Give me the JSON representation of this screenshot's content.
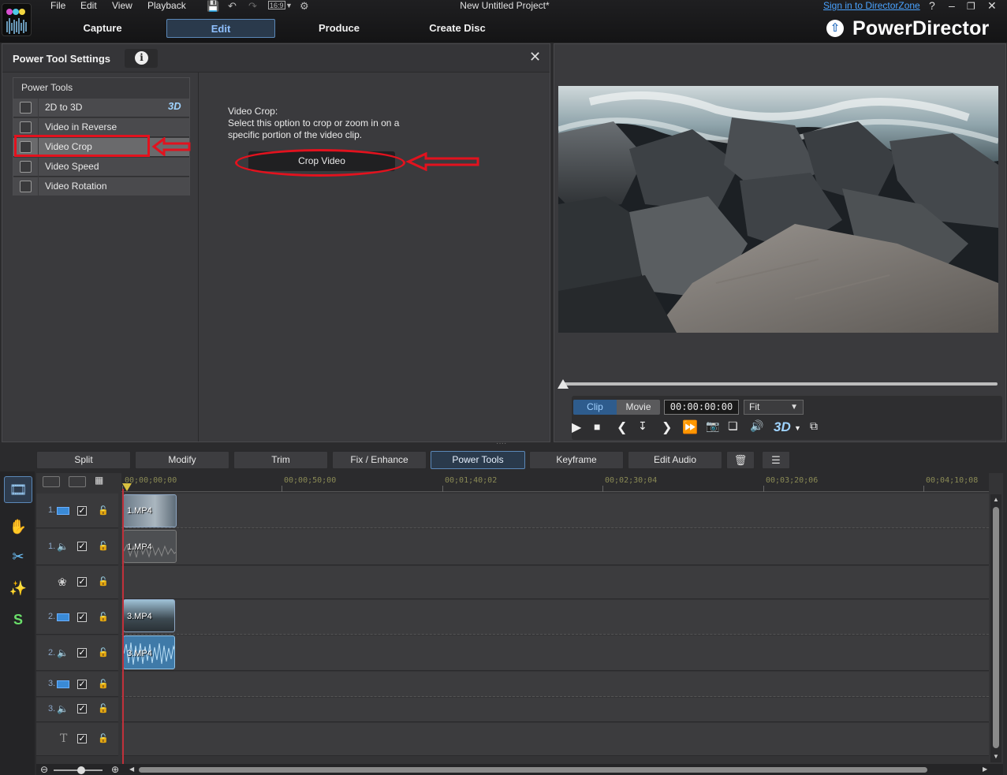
{
  "app": {
    "window_title": "New Untitled Project*",
    "brand": "PowerDirector",
    "sign_in": "Sign in to DirectorZone",
    "aspect_label": "16:9"
  },
  "menu": [
    "File",
    "Edit",
    "View",
    "Playback"
  ],
  "nav_tabs": [
    {
      "label": "Capture",
      "active": false
    },
    {
      "label": "Edit",
      "active": true
    },
    {
      "label": "Produce",
      "active": false
    },
    {
      "label": "Create Disc",
      "active": false
    }
  ],
  "power_tool_settings": {
    "title": "Power Tool Settings",
    "list_header": "Power Tools",
    "tools": [
      {
        "label": "2D to 3D",
        "badge": "3D"
      },
      {
        "label": "Video in Reverse"
      },
      {
        "label": "Video Crop",
        "selected": true
      },
      {
        "label": "Video Speed"
      },
      {
        "label": "Video Rotation"
      }
    ],
    "detail_title": "Video Crop:",
    "detail_desc": "Select this option to crop or zoom in on a specific portion of the video clip.",
    "crop_button": "Crop Video"
  },
  "preview": {
    "clip_tab": "Clip",
    "movie_tab": "Movie",
    "timecode": "00:00:00:00",
    "fit": "Fit",
    "threed": "3D"
  },
  "toolbar": [
    "Split",
    "Modify",
    "Trim",
    "Fix / Enhance",
    "Power Tools",
    "Keyframe",
    "Edit Audio"
  ],
  "active_tool_button": "Power Tools",
  "ruler": [
    "00;00;00;00",
    "00;00;50;00",
    "00;01;40;02",
    "00;02;30;04",
    "00;03;20;06",
    "00;04;10;08"
  ],
  "tracks": {
    "v1": "1.",
    "a1": "1.",
    "v2": "2.",
    "a2": "2.",
    "v3": "3.",
    "a3": "3."
  },
  "clips": {
    "c1_video": "1.MP4",
    "c1_audio": "1.MP4",
    "c2_video": "3.MP4",
    "c2_audio": "3.MP4"
  },
  "colors": {
    "accent": "#5b88b8",
    "annotation": "#e2121e",
    "playhead": "#c0303a"
  }
}
